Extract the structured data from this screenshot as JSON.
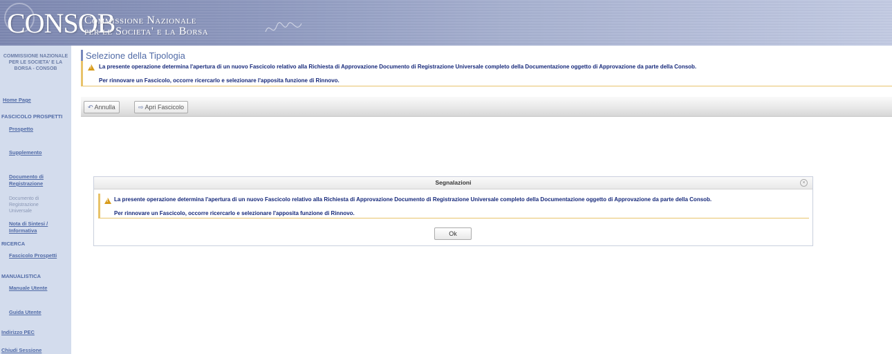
{
  "header": {
    "logo": "CONSOB",
    "subtitle_line1": "Commissione Nazionale",
    "subtitle_line2": "per le Societa' e la Borsa"
  },
  "sidebar": {
    "org": "COMMISSIONE NAZIONALE PER LE SOCIETA' E LA BORSA - CONSOB",
    "home": "Home Page",
    "section_fascicolo": "FASCICOLO PROSPETTI",
    "prospetto": "Prospetto",
    "supplemento": "Supplemento",
    "documento_reg_1": "Documento di",
    "documento_reg_2": "Registrazione",
    "doc_universale_1": "Documento di",
    "doc_universale_2": "Registrazione",
    "doc_universale_3": "Universale",
    "nota_1": "Nota di Sintesi /",
    "nota_2": "Informativa",
    "section_ricerca": "RICERCA",
    "fascicolo_prospetti": "Fascicolo Prospetti",
    "section_manualistica": "MANUALISTICA",
    "manuale": "Manuale Utente",
    "guida": "Guida Utente",
    "pec": "Indirizzo PEC",
    "chiudi": "Chiudi Sessione"
  },
  "main": {
    "title": "Selezione della Tipologia",
    "warning_line1": "La presente operazione determina l'apertura di un nuovo Fascicolo relativo alla Richiesta di Approvazione Documento di Registrazione Universale completo della Documentazione oggetto di Approvazione da parte della Consob.",
    "warning_line2": "Per rinnovare un Fascicolo, occorre ricercarlo e selezionare l'apposita funzione di Rinnovo."
  },
  "toolbar": {
    "annulla": "Annulla",
    "apri": "Apri Fascicolo"
  },
  "dialog": {
    "title": "Segnalazioni",
    "line1": "La presente operazione determina l'apertura di un nuovo Fascicolo relativo alla Richiesta di Approvazione Documento di Registrazione Universale completo della Documentazione oggetto di Approvazione da parte della Consob.",
    "line2": "Per rinnovare un Fascicolo, occorre ricercarlo e selezionare l'apposita funzione di Rinnovo.",
    "ok": "Ok"
  }
}
